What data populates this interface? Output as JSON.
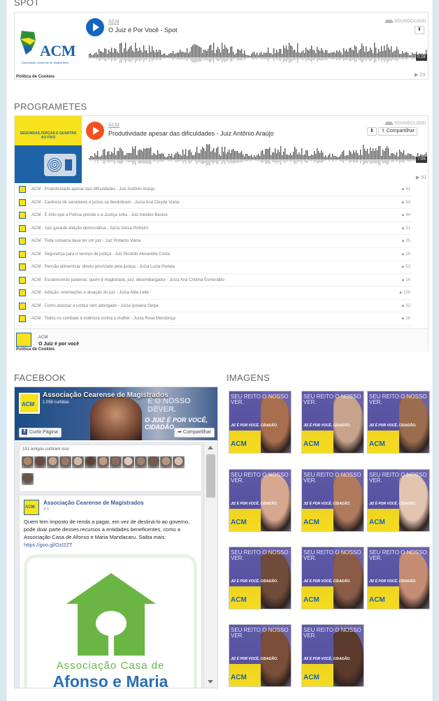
{
  "sections": {
    "spot": "SPOT",
    "programetes": "PROGRAMETES",
    "facebook": "FACEBOOK",
    "imagens": "IMAGENS"
  },
  "player1": {
    "user": "ACM",
    "title": "O Juiz é Por Você - Spot",
    "logo": "SOUNDCLOUD",
    "duration": "0:28",
    "plays": "23",
    "cookies": "Política de Cookies",
    "art_text": "ACM",
    "art_sub": "Associação Cearense de Magistrados"
  },
  "player2": {
    "user": "ACM",
    "title": "Produtividade apesar das dificuldades - Juiz Antônio Araújo",
    "logo": "SOUNDCLOUD",
    "share": "Compartilhar",
    "duration": "7:05",
    "plays": "91",
    "art_text": "SEGUNDAS,TERÇAS E QUARTAS AO FIXO",
    "cookies": "Política de Cookies",
    "footer_user": "ACM",
    "footer_title": "O Juiz é por você"
  },
  "playlist": [
    {
      "text": "ACM · Produtividade apesar das dificuldades - Juiz Antônio Araújo",
      "count": "91"
    },
    {
      "text": "ACM · Carência de servidores e juízes se desdobram - Juíza Ana Cleyde Viana",
      "count": "63"
    },
    {
      "text": "ACM · É mito que a Polícia prende e a Justiça solta - Juiz Irandes Bastos",
      "count": "44"
    },
    {
      "text": "ACM · Juiz garante eleição democrática - Juíza Joriza Pinheiro",
      "count": "31"
    },
    {
      "text": "ACM · Toda comarca deve ter um juiz - Juiz Roberto Viana",
      "count": "35"
    },
    {
      "text": "ACM · Segurança para o serviço de justiça - Juiz Ricardo Alexandre Costa",
      "count": "29"
    },
    {
      "text": "ACM · Pensão alimentícia: direito priorizado pela justiça - Juíza Luzia Portela",
      "count": "53"
    },
    {
      "text": "ACM · Esclarecendo palavras: quem é magistrado, juiz, desembargador - Juíza Ana Cristina Esmeraldo",
      "count": "14"
    },
    {
      "text": "ACM · Adoção: orientações e atuação do juiz - Juíza Alda Leite",
      "count": "105"
    },
    {
      "text": "ACM · Como acessar a justiça sem advogado - Juíza Ijosiana Serpa",
      "count": "32"
    },
    {
      "text": "ACM · Todos no combate à violência contra a mulher - Juíza Rosa Mendonça",
      "count": "18"
    }
  ],
  "facebook": {
    "page_name": "Associação Cearense de Magistrados",
    "likes": "1.058 curtidas",
    "like_btn": "Curtir Página",
    "share_btn": "Compartilhar",
    "cover_slogan": "É O NOSSO DEVER.",
    "cover_slogan2": "O JUIZ É POR VOCÊ, CIDADÃO.",
    "friends_label": "151 amigos curtiram isso",
    "avatar_text": "ACM",
    "post_author": "Associação Cearense de Magistrados",
    "post_time": "3 h",
    "post_text": "Quem tem imposto de renda a pagar, em vez de destiná-lo ao governo, pode doar parte desses recursos a entidades beneficentes, como a Associação Casa de Afonso e Maria Mandacaru. Saiba mais:",
    "post_link": "https://goo.gl/Ozl2ZT",
    "casa_l1": "Associação Casa de",
    "casa_l2": "Afonso e Maria"
  },
  "tile_text": {
    "t1": "SEU REITO O NOSSO VER.",
    "t2": "JIZ É POR VOCÊ, CIDADÃO.",
    "t3": "ACM"
  },
  "colors": {
    "sc_blue": "#1565c0",
    "sc_orange": "#f5501e",
    "acm_yellow": "#f6e21d",
    "acm_blue": "#1e63a8",
    "fb_blue": "#3b5998"
  }
}
